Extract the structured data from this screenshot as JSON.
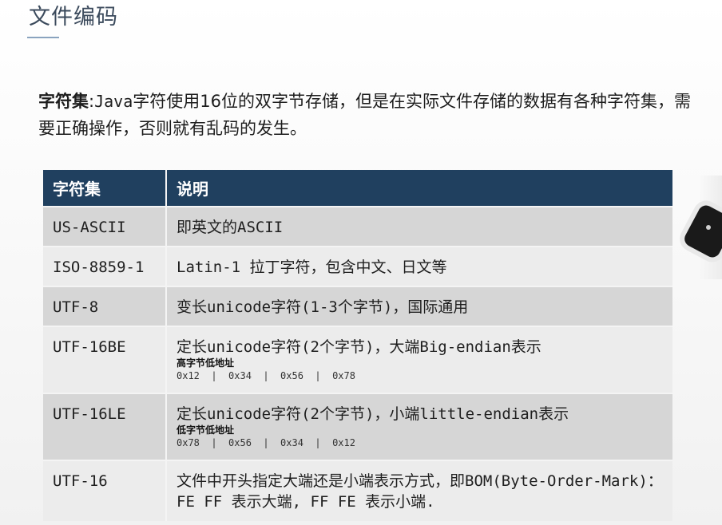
{
  "slide": {
    "title": "文件编码"
  },
  "intro": {
    "term": "字符集",
    "colon": ":",
    "lang": "Java",
    "text_1": "字符使用",
    "bits": "16",
    "text_2": "位的双字节存储，但是在实际文件存储的数据有各种字符集，需要正确操作，否则就有乱码的发生。"
  },
  "table": {
    "headers": [
      "字符集",
      "说明"
    ],
    "rows": [
      {
        "name": "US-ASCII",
        "desc": "即英文的ASCII"
      },
      {
        "name": "ISO-8859-1",
        "desc": "Latin-1 拉丁字符，包含中文、日文等"
      },
      {
        "name": "UTF-8",
        "desc": "变长unicode字符(1-3个字节)，国际通用"
      },
      {
        "name": "UTF-16BE",
        "desc": "定长unicode字符(2个字节)，大端Big-endian表示",
        "note": "高字节低地址",
        "bytes": "0x12  |  0x34  |  0x56  |  0x78"
      },
      {
        "name": "UTF-16LE",
        "desc": "定长unicode字符(2个字节)，小端little-endian表示",
        "note": "低字节低地址",
        "bytes": "0x78  |  0x56  |  0x34  |  0x12"
      },
      {
        "name": "UTF-16",
        "desc": "文件中开头指定大端还是小端表示方式，即BOM(Byte-Order-Mark)：FE FF 表示大端, FF FE 表示小端."
      }
    ]
  },
  "colors": {
    "header_bg": "#20405f",
    "row_dark": "#d6d6d6",
    "row_light": "#ececec",
    "title": "#3b4a5c"
  }
}
